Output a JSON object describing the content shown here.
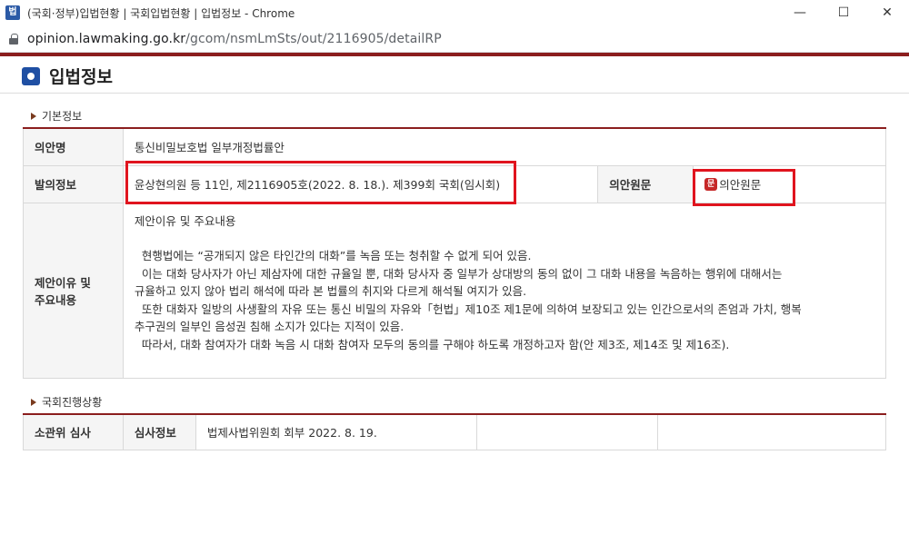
{
  "window": {
    "app_icon": "법",
    "title": "(국회·정부)입법현황 | 국회입법현황 | 입법정보 - Chrome",
    "minimize": "—",
    "maximize": "☐",
    "close": "✕"
  },
  "address": {
    "host": "opinion.lawmaking.go.kr",
    "path": "/gcom/nsmLmSts/out/2116905/detailRP"
  },
  "page": {
    "title": "입법정보"
  },
  "basic": {
    "section_title": "기본정보",
    "bill_name_label": "의안명",
    "bill_name": "통신비밀보호법 일부개정법률안",
    "proposal_label": "발의정보",
    "proposal": "윤상현의원 등 11인, 제2116905호(2022. 8. 18.). 제399회 국회(임시회)",
    "original_label": "의안원문",
    "original_link": "의안원문",
    "original_icon": "pdf-icon",
    "reason_label_1": "제안이유 및",
    "reason_label_2": "주요내용",
    "reason_heading": "제안이유 및 주요내용",
    "reason_lines": [
      "현행법에는 “공개되지 않은 타인간의 대화”를 녹음 또는 청취할 수 없게 되어 있음.",
      "이는 대화 당사자가 아닌 제삼자에 대한 규율일 뿐, 대화 당사자 중 일부가 상대방의 동의 없이 그 대화 내용을 녹음하는 행위에 대해서는",
      "규율하고 있지 않아 법리 해석에 따라 본 법률의 취지와 다르게 해석될 여지가 있음.",
      "또한 대화자 일방의 사생활의 자유 또는 통신 비밀의 자유와「헌법」제10조 제1문에 의하여 보장되고 있는 인간으로서의 존엄과 가치, 행복",
      "추구권의 일부인 음성권 침해 소지가 있다는 지적이 있음.",
      "따라서, 대화 참여자가 대화 녹음 시 대화 참여자 모두의 동의를 구해야 하도록 개정하고자 함(안 제3조, 제14조 및 제16조)."
    ]
  },
  "progress": {
    "section_title": "국회진행상황",
    "committee_label": "소관위 심사",
    "review_label": "심사정보",
    "review_value": "법제사법위원회 회부 2022. 8. 19."
  },
  "colors": {
    "accent_red": "#8b1e1e",
    "highlight_red": "#e0141e",
    "header_blue": "#1f4fa3"
  }
}
